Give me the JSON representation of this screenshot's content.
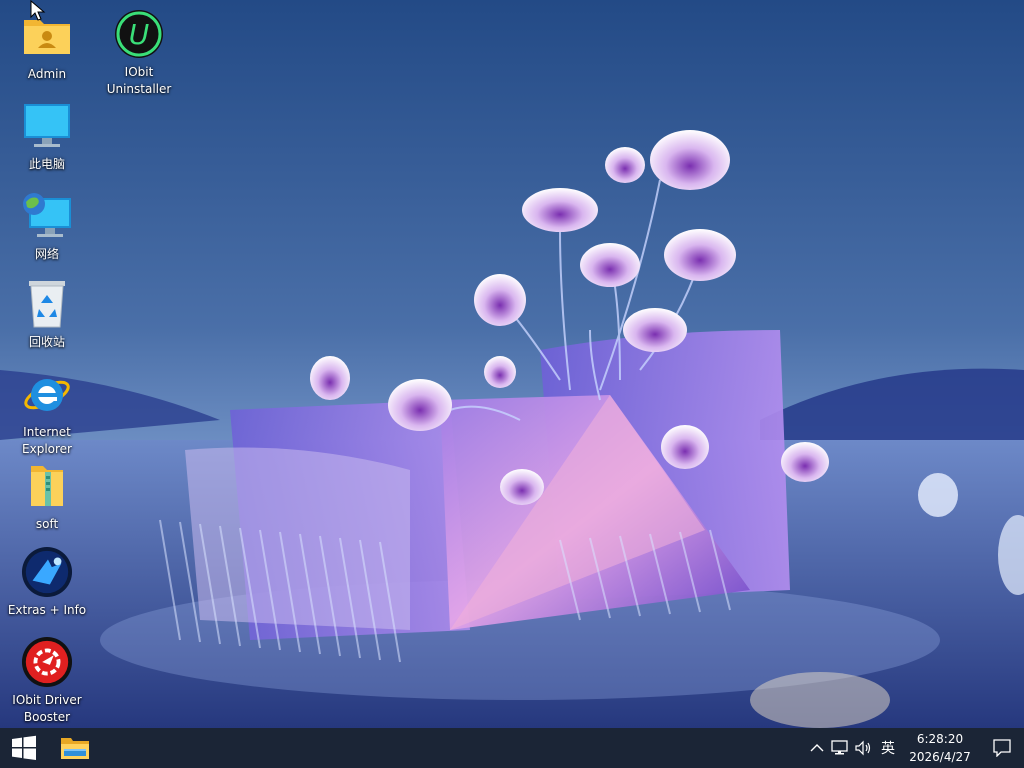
{
  "desktop": {
    "icons": [
      {
        "label": "Admin",
        "icon": "user-folder-icon"
      },
      {
        "label": "IObit\nUninstaller",
        "icon": "iobit-uninstaller-icon"
      },
      {
        "label": "此电脑",
        "icon": "computer-icon"
      },
      {
        "label": "网络",
        "icon": "network-icon"
      },
      {
        "label": "回收站",
        "icon": "recycle-bin-icon"
      },
      {
        "label": "Internet\nExplorer",
        "icon": "internet-explorer-icon"
      },
      {
        "label": "soft",
        "icon": "zip-folder-icon"
      },
      {
        "label": "Extras + Info",
        "icon": "extras-info-icon"
      },
      {
        "label": "IObit Driver\nBooster",
        "icon": "driver-booster-icon"
      }
    ]
  },
  "taskbar": {
    "start_icon": "windows-logo-icon",
    "pinned": [
      {
        "icon": "file-explorer-icon"
      }
    ],
    "tray": {
      "chevron_icon": "chevron-up-icon",
      "network_icon": "network-tray-icon",
      "volume_icon": "volume-icon",
      "ime_label": "英",
      "time": "6:28:20",
      "date": "2026/4/27",
      "notification_icon": "action-center-icon"
    }
  },
  "colors": {
    "taskbar_bg": "#1b2536",
    "accent": "#0078d7"
  }
}
